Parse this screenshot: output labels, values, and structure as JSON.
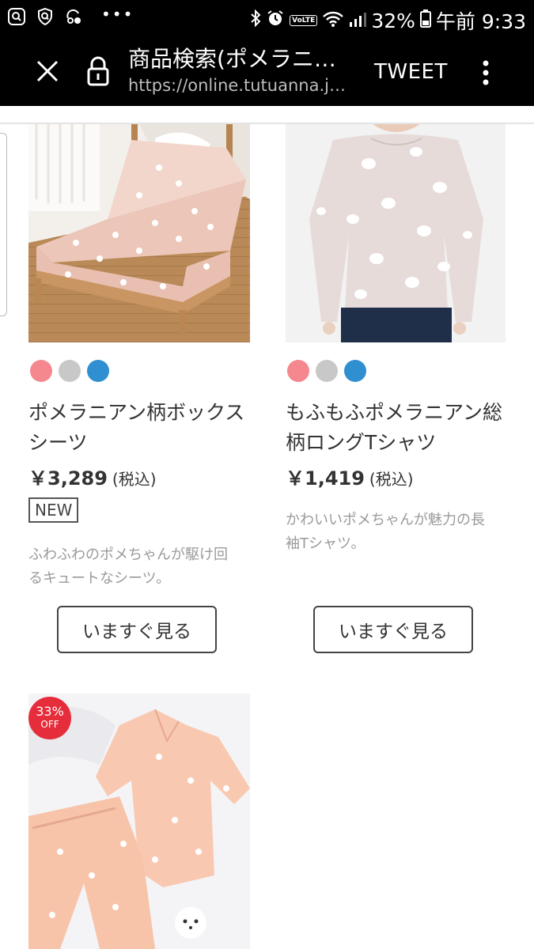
{
  "status_bar": {
    "battery_percent": "32%",
    "clock": "午前 9:33",
    "network_badge": "VoLTE",
    "icons": [
      "privacy-q-icon",
      "shield-q-icon",
      "sync-icon",
      "more-dots-icon",
      "bluetooth-icon",
      "alarm-icon",
      "wifi-icon",
      "signal-icon",
      "battery-icon"
    ]
  },
  "app_bar": {
    "title": "商品検索(ポメラニ…",
    "url": "https://online.tutuanna.j…",
    "tweet_label": "TWEET"
  },
  "products": [
    {
      "name_line1": "ポメラニアン柄ボックス",
      "name_line2": "シーツ",
      "price": "￥3,289",
      "tax_label": "(税込)",
      "badge": "NEW",
      "desc_line1": "ふわふわのポメちゃんが駆け回",
      "desc_line2": "るキュートなシーツ。",
      "cta": "いますぐ見る",
      "swatches": [
        "#f4888e",
        "#c8c8c8",
        "#2f8fd0"
      ]
    },
    {
      "name_line1": "もふもふポメラニアン総",
      "name_line2": "柄ロングTシャツ",
      "price": "￥1,419",
      "tax_label": "(税込)",
      "desc_line1": "かわいいポメちゃんが魅力の長",
      "desc_line2": "袖Tシャツ。",
      "cta": "いますぐ見る",
      "swatches": [
        "#f4888e",
        "#c8c8c8",
        "#2f8fd0"
      ]
    },
    {
      "sale_percent": "33%",
      "sale_off": "OFF"
    }
  ],
  "colors": {
    "status_bar_bg": "#000000",
    "sale_red": "#e52d3b"
  }
}
